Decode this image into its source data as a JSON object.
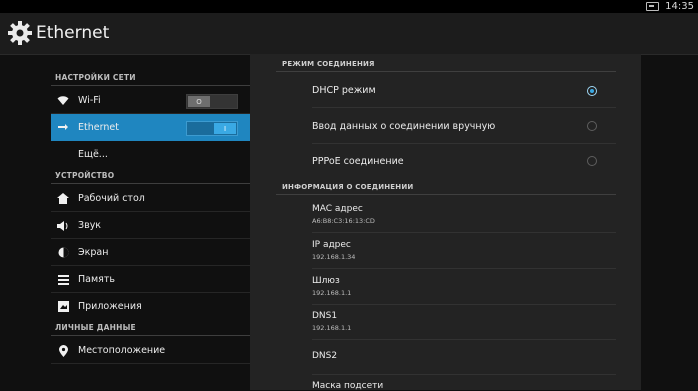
{
  "statusbar": {
    "time": "14:35",
    "icon": "screen-icon"
  },
  "actionbar": {
    "title": "Ethernet",
    "icon": "gear-icon"
  },
  "sidebar": {
    "sections": [
      {
        "label": "НАСТРОЙКИ СЕТИ"
      },
      {
        "label": "УСТРОЙСТВО"
      },
      {
        "label": "ЛИЧНЫЕ ДАННЫЕ"
      }
    ],
    "items": [
      {
        "label": "Wi-Fi",
        "icon": "wifi-icon",
        "toggle": "O",
        "toggle_state": "off"
      },
      {
        "label": "Ethernet",
        "icon": "ethernet-icon",
        "toggle": "I",
        "toggle_state": "on",
        "active": true
      },
      {
        "label": "Ещё..."
      },
      {
        "label": "Рабочий стол",
        "icon": "home-icon"
      },
      {
        "label": "Звук",
        "icon": "speaker-icon"
      },
      {
        "label": "Экран",
        "icon": "brightness-icon"
      },
      {
        "label": "Память",
        "icon": "storage-icon"
      },
      {
        "label": "Приложения",
        "icon": "apps-icon"
      },
      {
        "label": "Местоположение",
        "icon": "location-icon"
      }
    ]
  },
  "detail": {
    "mode_header": "РЕЖИМ СОЕДИНЕНИЯ",
    "modes": [
      {
        "label": "DHCP режим",
        "checked": true
      },
      {
        "label": "Ввод данных о соединении вручную",
        "checked": false
      },
      {
        "label": "PPPoE соединение",
        "checked": false
      }
    ],
    "info_header": "ИНФОРМАЦИЯ О СОЕДИНЕНИИ",
    "info": [
      {
        "title": "MAC адрес",
        "value": "A6:B8:C3:16:13:CD"
      },
      {
        "title": "IP адрес",
        "value": "192.168.1.34"
      },
      {
        "title": "Шлюз",
        "value": "192.168.1.1"
      },
      {
        "title": "DNS1",
        "value": "192.168.1.1"
      },
      {
        "title": "DNS2",
        "value": ""
      },
      {
        "title": "Маска подсети",
        "value": ""
      }
    ]
  },
  "colors": {
    "accent": "#1f86c0",
    "radio_checked": "#3aa9e4"
  }
}
